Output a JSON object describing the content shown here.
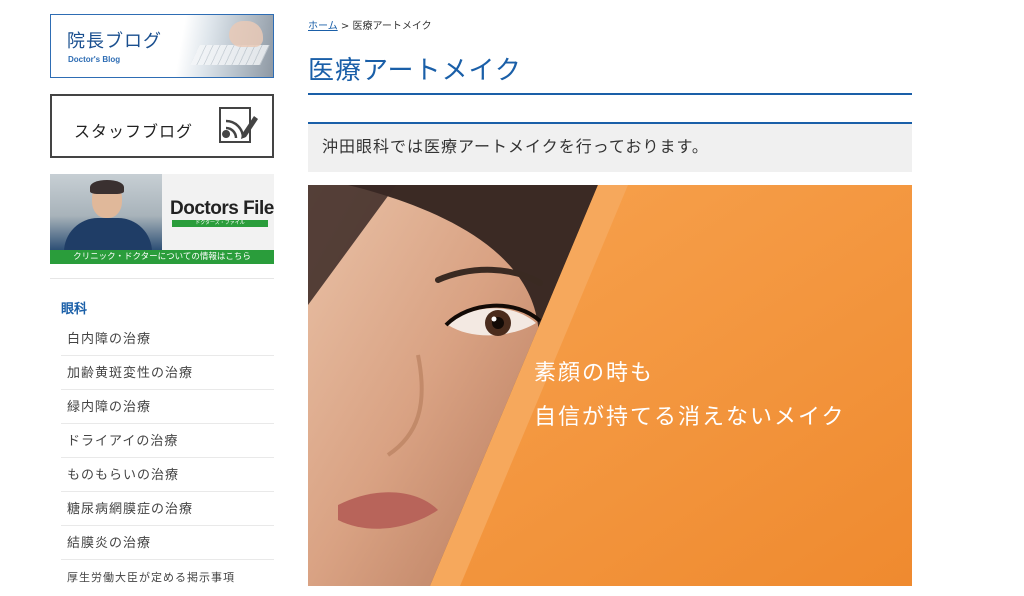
{
  "sidebar": {
    "blog_banner": {
      "title": "院長ブログ",
      "subtitle": "Doctor's Blog"
    },
    "staff_banner": {
      "title": "スタッフブログ"
    },
    "doctors_file": {
      "brand": "Doctors File",
      "brand_sub": "ドクターズ・ファイル",
      "caption": "クリニック・ドクターについての情報はこちら"
    },
    "category_title": "眼科",
    "menu": [
      "白内障の治療",
      "加齢黄斑変性の治療",
      "緑内障の治療",
      "ドライアイの治療",
      "ものもらいの治療",
      "糖尿病網膜症の治療",
      "結膜炎の治療",
      "厚生労働大臣が定める掲示事項"
    ]
  },
  "breadcrumb": {
    "home": "ホーム",
    "separator": ">",
    "current": "医療アートメイク"
  },
  "page_title": "医療アートメイク",
  "lead": "沖田眼科では医療アートメイクを行っております。",
  "hero": {
    "line1": "素顔の時も",
    "line2": "自信が持てる消えないメイク"
  },
  "colors": {
    "accent": "#1a5fa8",
    "hero_orange": "#f3953f",
    "green": "#2a9d3b"
  }
}
